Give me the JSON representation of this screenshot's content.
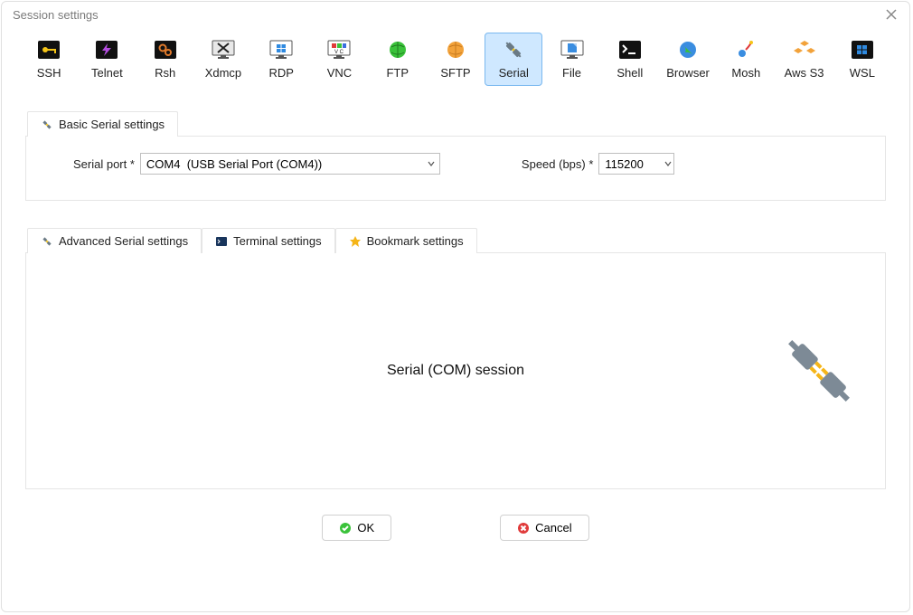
{
  "window": {
    "title": "Session settings"
  },
  "session_types": [
    {
      "id": "ssh",
      "label": "SSH"
    },
    {
      "id": "telnet",
      "label": "Telnet"
    },
    {
      "id": "rsh",
      "label": "Rsh"
    },
    {
      "id": "xdmcp",
      "label": "Xdmcp"
    },
    {
      "id": "rdp",
      "label": "RDP"
    },
    {
      "id": "vnc",
      "label": "VNC"
    },
    {
      "id": "ftp",
      "label": "FTP"
    },
    {
      "id": "sftp",
      "label": "SFTP"
    },
    {
      "id": "serial",
      "label": "Serial",
      "selected": true
    },
    {
      "id": "file",
      "label": "File"
    },
    {
      "id": "shell",
      "label": "Shell"
    },
    {
      "id": "browser",
      "label": "Browser"
    },
    {
      "id": "mosh",
      "label": "Mosh"
    },
    {
      "id": "awss3",
      "label": "Aws S3"
    },
    {
      "id": "wsl",
      "label": "WSL"
    }
  ],
  "basic_tab": {
    "label": "Basic Serial settings",
    "serial_port_label": "Serial port *",
    "serial_port_value": "COM4  (USB Serial Port (COM4))",
    "speed_label": "Speed (bps) *",
    "speed_value": "115200"
  },
  "lower_tabs": {
    "advanced": "Advanced Serial settings",
    "terminal": "Terminal settings",
    "bookmark": "Bookmark settings",
    "heading": "Serial (COM) session"
  },
  "buttons": {
    "ok": "OK",
    "cancel": "Cancel"
  }
}
